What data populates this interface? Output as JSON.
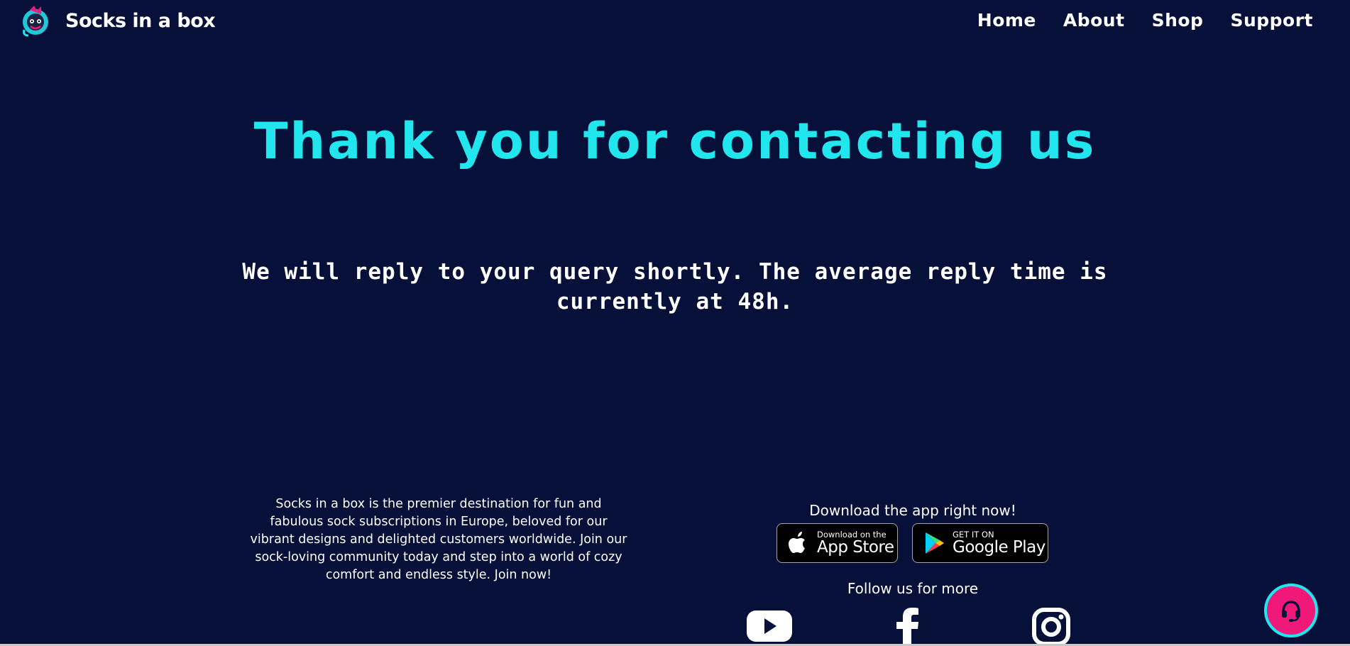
{
  "header": {
    "brand": "Socks in a box",
    "logo_icon": "sock-mascot-logo",
    "nav": [
      {
        "label": "Home"
      },
      {
        "label": "About"
      },
      {
        "label": "Shop"
      },
      {
        "label": "Support"
      }
    ]
  },
  "main": {
    "title": "Thank you for contacting us",
    "message": "We will reply to your query shortly. The average reply time is currently at 48h."
  },
  "footer": {
    "about_text": "Socks in a box is the premier destination for fun and fabulous sock subscriptions in Europe, beloved for our vibrant designs and delighted customers worldwide. Join our sock-loving community today and step into a world of cozy comfort and endless style. Join now!",
    "download_title": "Download the app right now!",
    "app_store": {
      "small": "Download on the",
      "big": "App Store",
      "icon": "apple-icon"
    },
    "google_play": {
      "small": "GET IT ON",
      "big": "Google Play",
      "icon": "google-play-icon"
    },
    "follow_title": "Follow us for more",
    "social": [
      "youtube-icon",
      "facebook-icon",
      "instagram-icon"
    ]
  },
  "support_fab": {
    "icon": "headset-icon"
  },
  "colors": {
    "background": "#061038",
    "accent_cyan": "#21e6ee",
    "accent_pink": "#f0197a",
    "text": "#ffffff"
  }
}
